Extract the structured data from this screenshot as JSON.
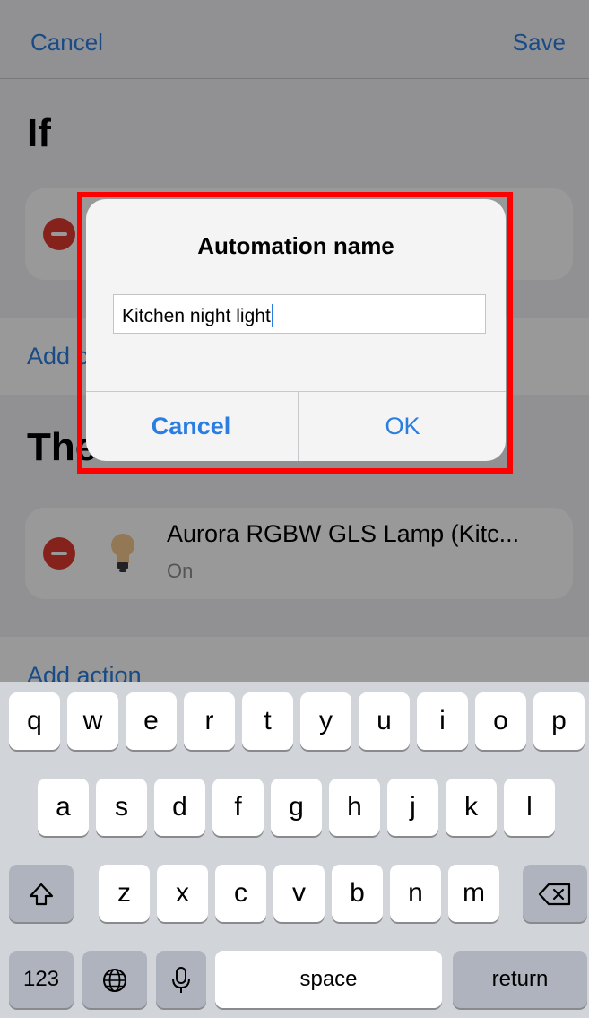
{
  "nav": {
    "cancel": "Cancel",
    "save": "Save"
  },
  "sections": {
    "if_title": "If",
    "then_title": "Then"
  },
  "add_condition": "Add c",
  "add_action": "Add action",
  "action_card": {
    "title": "Aurora RGBW GLS Lamp (Kitc...",
    "subtitle": "On"
  },
  "alert": {
    "title": "Automation name",
    "input_value": "Kitchen night light",
    "cancel": "Cancel",
    "ok": "OK"
  },
  "keyboard": {
    "row1": [
      "q",
      "w",
      "e",
      "r",
      "t",
      "y",
      "u",
      "i",
      "o",
      "p"
    ],
    "row2": [
      "a",
      "s",
      "d",
      "f",
      "g",
      "h",
      "j",
      "k",
      "l"
    ],
    "row3": [
      "z",
      "x",
      "c",
      "v",
      "b",
      "n",
      "m"
    ],
    "numbers": "123",
    "space": "space",
    "return": "return",
    "icons": [
      "shift-icon",
      "backspace-icon",
      "globe-icon",
      "microphone-icon"
    ]
  },
  "colors": {
    "accent": "#2a7de1",
    "destructive": "#e0392f",
    "highlight": "#ff0000"
  }
}
